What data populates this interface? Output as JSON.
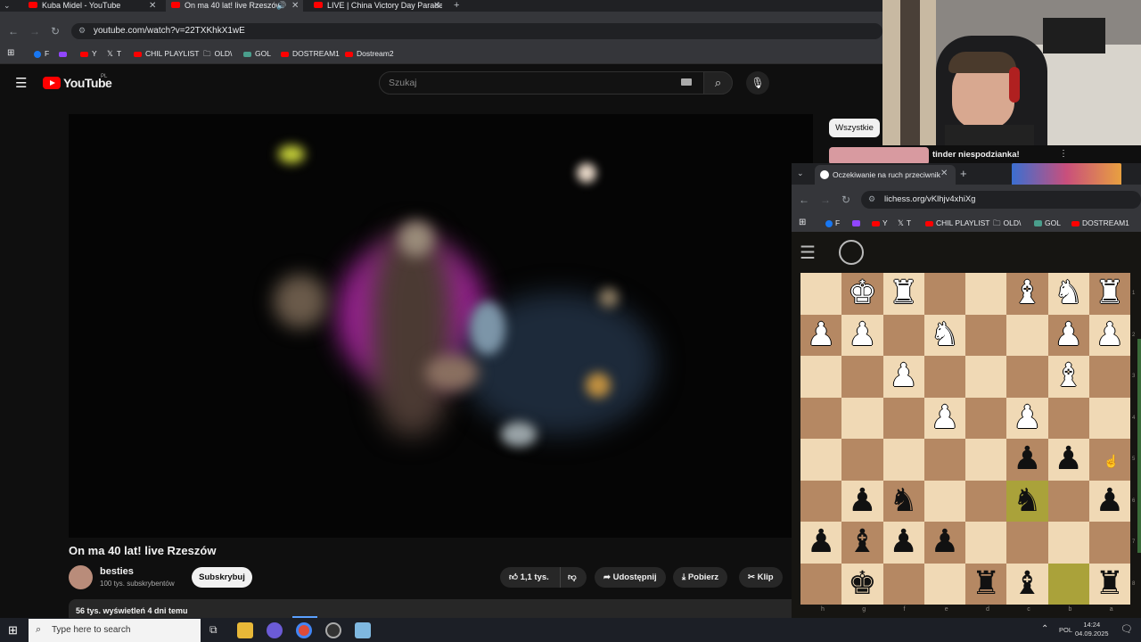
{
  "browser": {
    "tabs": [
      {
        "title": "Kuba Midel - YouTube",
        "active": false
      },
      {
        "title": "On ma 40 lat! live Rzeszów",
        "active": true
      },
      {
        "title": "LIVE | China Victory Day Parade",
        "active": false
      }
    ],
    "url": "youtube.com/watch?v=22TXKhkX1wE",
    "bookmarks": [
      "F",
      "Y",
      "T",
      "CHIL PLAYLIST",
      "OLD\\",
      "GOL",
      "DOSTREAM1",
      "Dostream2"
    ]
  },
  "youtube": {
    "logo_text": "YouTube",
    "region": "PL",
    "search_placeholder": "Szukaj",
    "video_title": "On ma 40 lat! live Rzeszów",
    "channel_name": "besties",
    "channel_subs": "100 tys. subskrybentów",
    "subscribe_label": "Subskrybuj",
    "likes": "1,1 tys.",
    "share_label": "Udostępnij",
    "download_label": "Pobierz",
    "clip_label": "Klip",
    "views_meta": "56 tys. wyświetleń  4 dni temu",
    "chip_all": "Wszystkie",
    "rec_title": "tinder niespodzianka!"
  },
  "lichess_window": {
    "tab_title": "Oczekiwanie na ruch przeciwnik",
    "url": "lichess.org/vKlhjv4xhiXg",
    "bookmarks": [
      "F",
      "Y",
      "T",
      "CHIL PLAYLIST",
      "OLD\\",
      "GOL",
      "DOSTREAM1"
    ],
    "board": [
      [
        "",
        "wK",
        "wR",
        "",
        "",
        "wB",
        "wN",
        "wR"
      ],
      [
        "wP",
        "wP",
        "",
        "wN",
        "",
        "",
        "wP",
        "wP"
      ],
      [
        "",
        "",
        "wP",
        "",
        "",
        "",
        "wB",
        ""
      ],
      [
        "",
        "",
        "",
        "wP",
        "",
        "wP",
        "",
        ""
      ],
      [
        "",
        "",
        "",
        "",
        "",
        "bP",
        "bP",
        ""
      ],
      [
        "",
        "bP",
        "bN",
        "",
        "",
        "bN",
        "",
        "bP"
      ],
      [
        "bP",
        "bB",
        "bP",
        "bP",
        "",
        "",
        "",
        ""
      ],
      [
        "",
        "bK",
        "",
        "",
        "bR",
        "bB",
        "",
        "bR"
      ]
    ],
    "highlighted": [
      [
        5,
        5
      ],
      [
        7,
        6
      ]
    ],
    "files": [
      "h",
      "g",
      "f",
      "e",
      "d",
      "c",
      "b",
      "a"
    ],
    "ranks": [
      "1",
      "2",
      "3",
      "4",
      "5",
      "6",
      "7",
      "8"
    ]
  },
  "taskbar": {
    "search_placeholder": "Type here to search",
    "lang": "POL",
    "time": "14:24",
    "date": "04.09.2025"
  }
}
